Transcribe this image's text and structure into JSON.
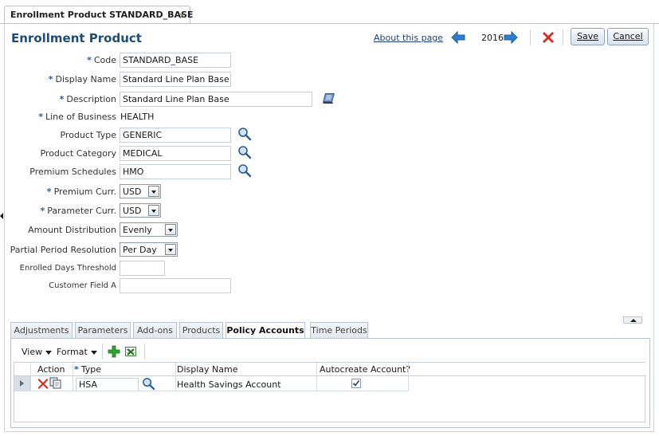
{
  "tab": {
    "label": "Enrollment Product STANDARD_BASE",
    "close": "×"
  },
  "header": {
    "title": "Enrollment Product",
    "about_link": "About this page",
    "year": "2016",
    "save_label": "Save",
    "cancel_label": "Cancel"
  },
  "form": {
    "code": {
      "label": "Code",
      "value": "STANDARD_BASE"
    },
    "display_name": {
      "label": "Display Name",
      "value": "Standard Line Plan Base"
    },
    "description": {
      "label": "Description",
      "value": "Standard Line Plan Base"
    },
    "line_of_business": {
      "label": "Line of Business",
      "value": "HEALTH"
    },
    "product_type": {
      "label": "Product Type",
      "value": "GENERIC"
    },
    "product_category": {
      "label": "Product Category",
      "value": "MEDICAL"
    },
    "premium_schedules": {
      "label": "Premium Schedules",
      "value": "HMO"
    },
    "premium_curr": {
      "label": "Premium Curr.",
      "value": "USD"
    },
    "parameter_curr": {
      "label": "Parameter Curr.",
      "value": "USD"
    },
    "amount_distribution": {
      "label": "Amount Distribution",
      "value": "Evenly"
    },
    "partial_period_resolution": {
      "label": "Partial Period Resolution",
      "value": "Per Day"
    },
    "enrolled_days_threshold": {
      "label": "Enrolled Days Threshold",
      "value": ""
    },
    "customer_field_a": {
      "label": "Customer Field A",
      "value": ""
    }
  },
  "subtabs": [
    "Adjustments",
    "Parameters",
    "Add-ons",
    "Products",
    "Policy Accounts",
    "Time Periods"
  ],
  "active_subtab": "Policy Accounts",
  "table_toolbar": {
    "view_label": "View",
    "format_label": "Format"
  },
  "table": {
    "columns": [
      "Action",
      "Type",
      "Display Name",
      "Autocreate Account?"
    ],
    "rows": [
      {
        "type": "HSA",
        "display_name": "Health Savings Account",
        "autocreate": true
      }
    ]
  },
  "colors": {
    "title": "#1f4d7a",
    "link": "#1f3f77",
    "required": "#2a5fa0",
    "nav_arrow": "#2f7fd1",
    "delete": "#d62b1f",
    "add": "#2fa52f"
  }
}
